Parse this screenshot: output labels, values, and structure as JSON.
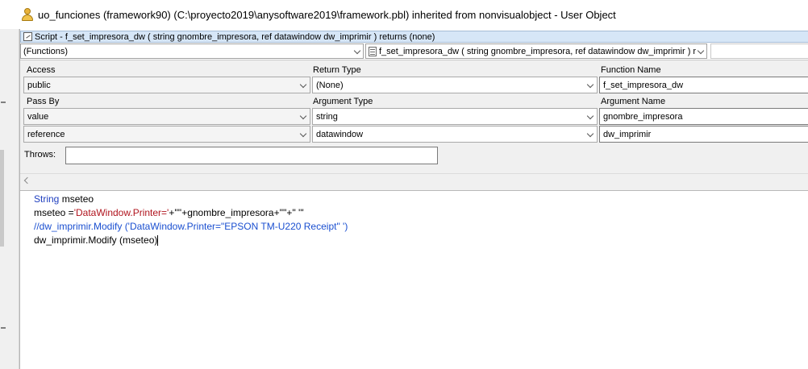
{
  "window": {
    "title": "uo_funciones (framework90) (C:\\proyecto2019\\anysoftware2019\\framework.pbl) inherited from nonvisualobject - User Object",
    "icon": "user-object-icon"
  },
  "script": {
    "title": "Script - f_set_impresora_dw ( string gnombre_impresora, ref datawindow dw_imprimir ) returns (none)",
    "icon": "script-icon",
    "object_select": "(Functions)",
    "event_select": "f_set_impresora_dw ( string gnombre_impresora, ref datawindow dw_imprimir ) r"
  },
  "declaration": {
    "labels": {
      "access": "Access",
      "return_type": "Return Type",
      "function_name": "Function Name",
      "pass_by": "Pass By",
      "argument_type": "Argument Type",
      "argument_name": "Argument Name",
      "throws": "Throws:"
    },
    "access": "public",
    "return_type": "(None)",
    "function_name": "f_set_impresora_dw",
    "arguments": [
      {
        "pass_by": "value",
        "type": "string",
        "name": "gnombre_impresora"
      },
      {
        "pass_by": "reference",
        "type": "datawindow",
        "name": "dw_imprimir"
      }
    ],
    "throws": ""
  },
  "code": {
    "line1_kw": "String",
    "line1_rest": " mseteo",
    "line2_a": "mseteo =",
    "line2_b": "'DataWindow.Printer='",
    "line2_c": "+'\"'+gnombre_impresora+'\"'+\" '\"",
    "line3": "//dw_imprimir.Modify ('DataWindow.Printer=\"EPSON TM-U220 Receipt\" ')",
    "line4": "dw_imprimir.Modify (mseteo)"
  },
  "colors": {
    "keyword": "#1f3fbf",
    "string": "#b0141e",
    "comment": "#1a4fd0",
    "title_bar": "#d6e6f7"
  }
}
